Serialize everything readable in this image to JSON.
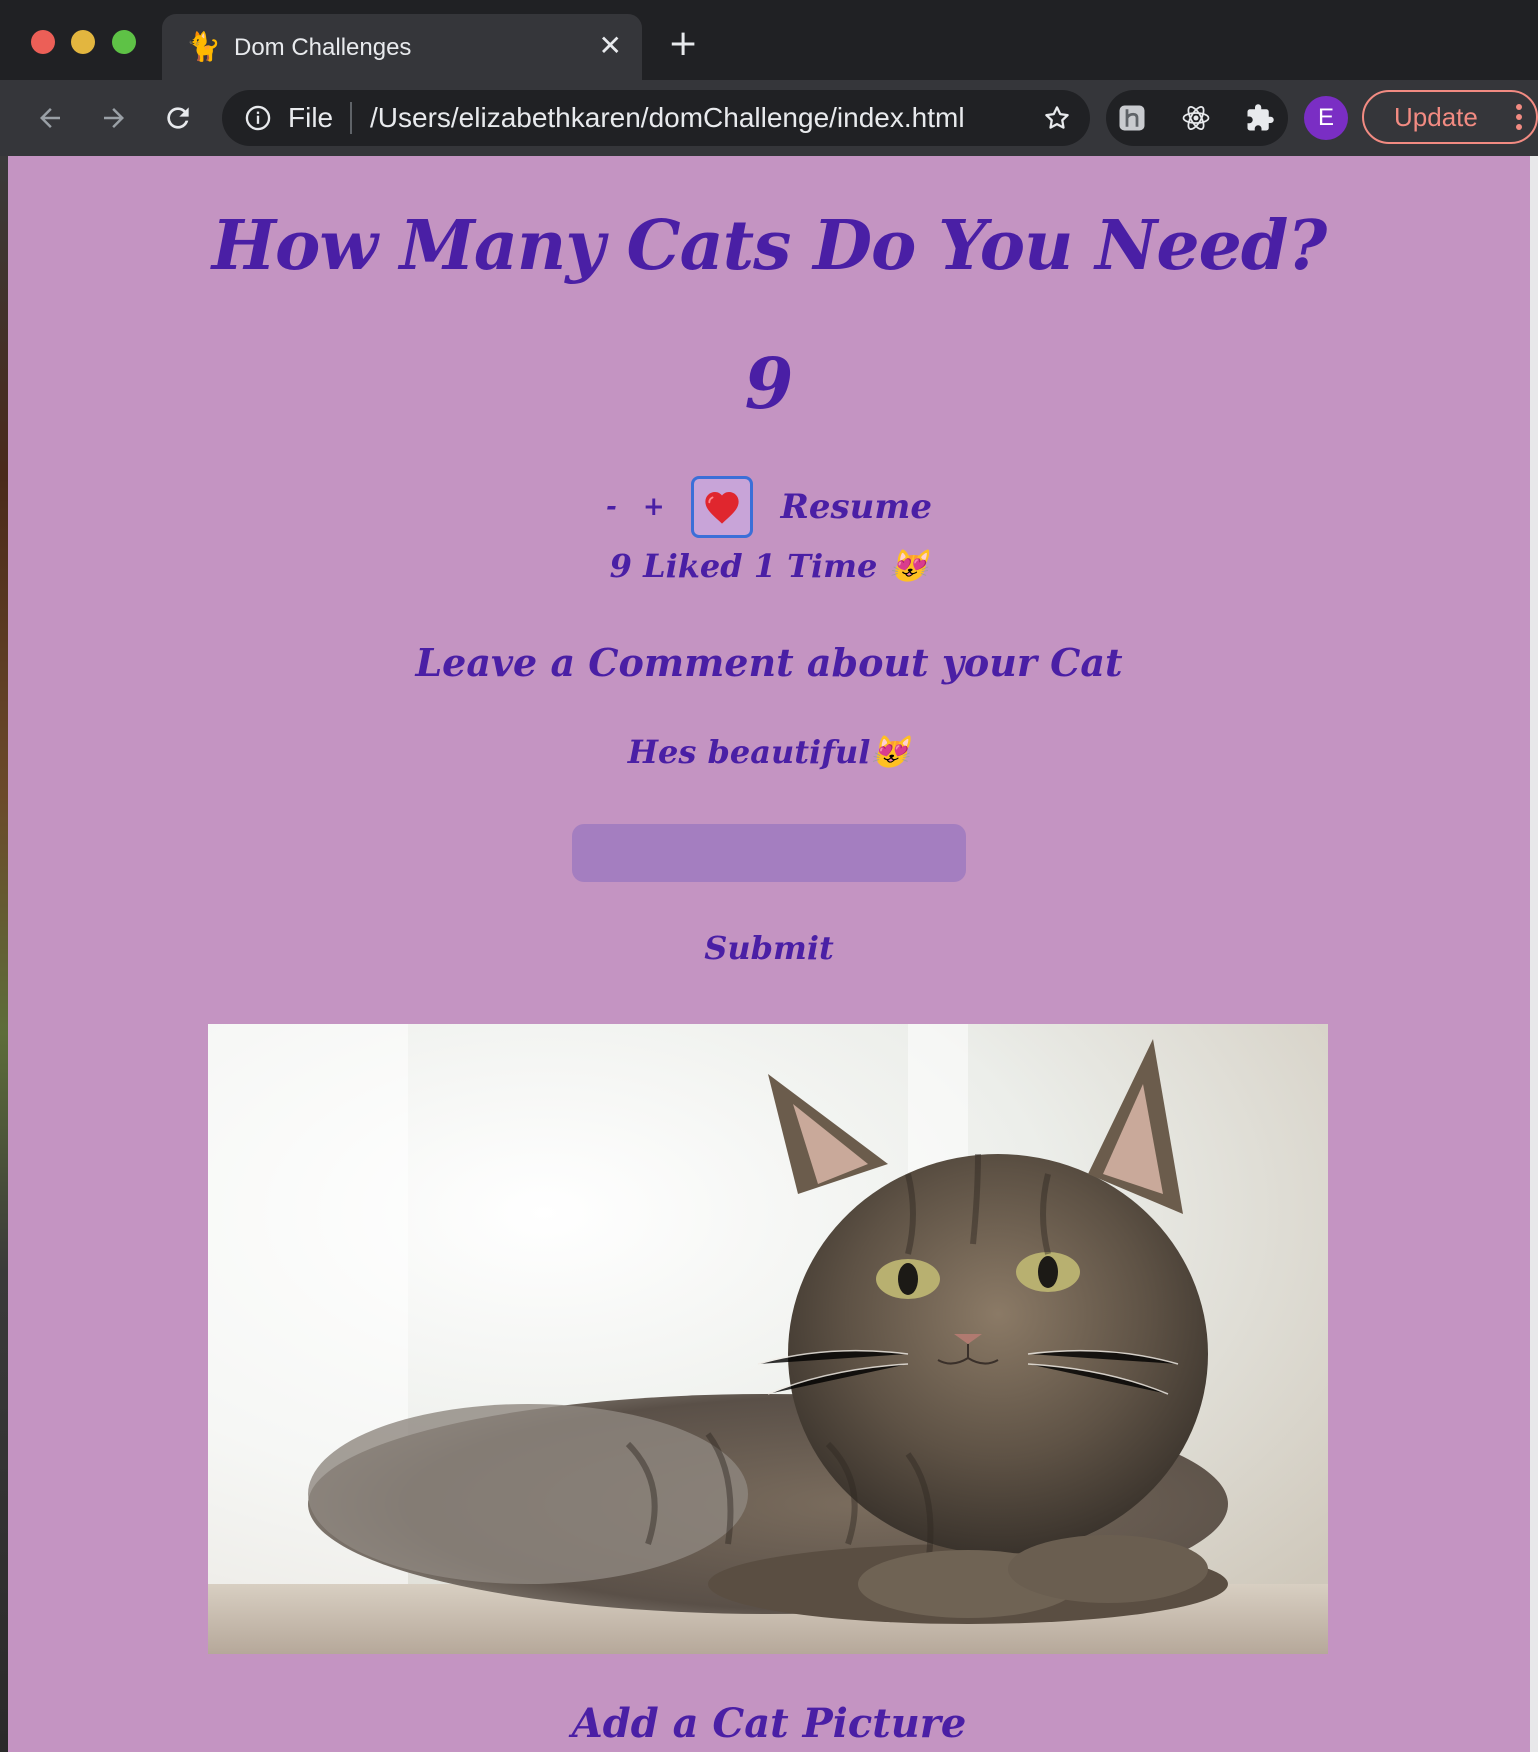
{
  "browser": {
    "tab": {
      "favicon": "🐈",
      "title": "Dom Challenges",
      "close_glyph": "✕"
    },
    "new_tab_glyph": "+",
    "omnibox": {
      "scheme_label": "File",
      "url": "/Users/elizabethkaren/domChallenge/index.html"
    },
    "profile_initial": "E",
    "update_label": "Update"
  },
  "page": {
    "heading": "How Many Cats Do You Need?",
    "counter_value": "9",
    "controls": {
      "minus_label": "-",
      "plus_label": "+",
      "heart_glyph": "❤️",
      "resume_label": "Resume"
    },
    "likes_text": "9 Liked 1 Time 😻",
    "comment_heading": "Leave a Comment about your Cat",
    "comments": [
      "Hes beautiful😻"
    ],
    "comment_input": {
      "value": "",
      "placeholder": ""
    },
    "submit_label": "Submit",
    "add_picture_heading": "Add a Cat Picture"
  },
  "colors": {
    "page_background": "#c494c2",
    "text_purple": "#4a1fa5",
    "input_background": "#a47ec0",
    "heart_button_border": "#3b6fd8",
    "update_accent": "#f28b82",
    "avatar_purple": "#7a2ec4"
  }
}
